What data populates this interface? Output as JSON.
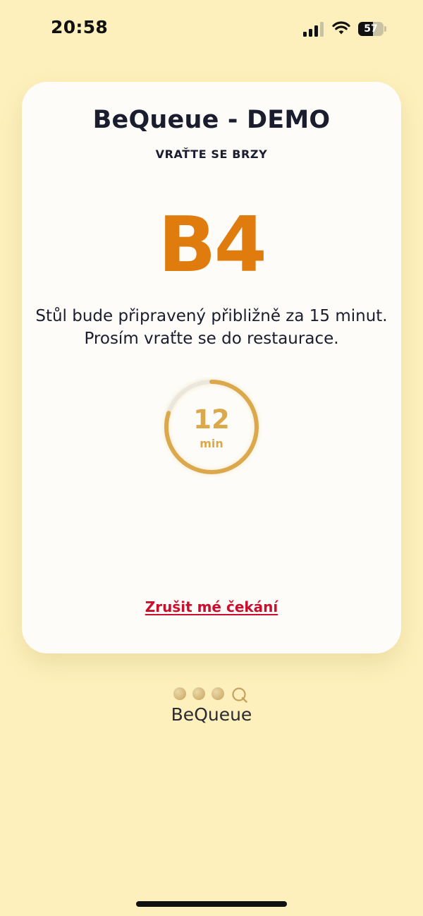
{
  "status_bar": {
    "time": "20:58",
    "battery_level": "57",
    "icons": [
      "signal-icon",
      "wifi-icon",
      "battery-icon"
    ]
  },
  "card": {
    "title": "BeQueue - DEMO",
    "subtitle": "VRAŤTE SE BRZY",
    "queue_code": "B4",
    "message": "Stůl bude připravený přibližně za 15 minut. Prosím vraťte se do restaurace.",
    "timer": {
      "value": "12",
      "unit": "min",
      "progress_fraction": 0.8
    },
    "cancel_label": "Zrušit mé čekání"
  },
  "footer": {
    "brand": "BeQueue",
    "logo_icon": "bequeue-logo-icon"
  },
  "colors": {
    "background": "#fdf0bc",
    "card": "#fdfcf8",
    "accent_orange": "#e07c0e",
    "timer_gold": "#dba84c",
    "cancel_red": "#c8102e",
    "text_dark": "#1a1d2e"
  }
}
